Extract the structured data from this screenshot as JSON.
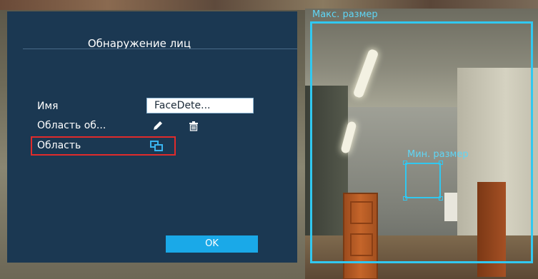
{
  "dialog": {
    "title": "Обнаружение лиц",
    "name_label": "Имя",
    "name_value": "FaceDete...",
    "detection_area_label": "Область об...",
    "area_label": "Область",
    "ok_label": "OK"
  },
  "overlay": {
    "max_size_label": "Макс. размер",
    "min_size_label": "Мин. размер"
  },
  "icons": {
    "edit": "pencil-icon",
    "delete": "trash-icon",
    "area": "area-select-icon"
  },
  "colors": {
    "dialog_bg": "#1b3852",
    "accent": "#1aa9e8",
    "overlay_box": "#31c8f0",
    "highlight": "#e12b2b"
  }
}
